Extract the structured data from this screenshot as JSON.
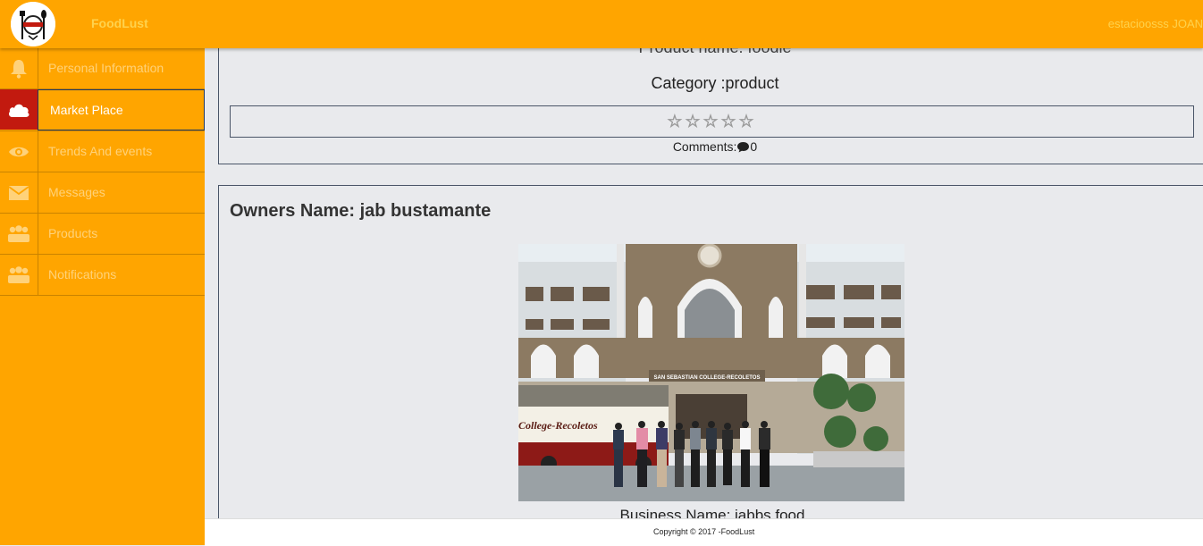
{
  "header": {
    "brand": "FoodLust",
    "user": "estacioosss JOAN",
    "colors": {
      "bar": "#ffa500",
      "brand_text": "#ffd24d"
    }
  },
  "sidebar": {
    "items": [
      {
        "label": "Personal Information",
        "icon": "bell-icon"
      },
      {
        "label": "Market Place",
        "icon": "cloud-icon",
        "active": true
      },
      {
        "label": "Trends And events",
        "icon": "eye-icon"
      },
      {
        "label": "Messages",
        "icon": "envelope-icon"
      },
      {
        "label": "Products",
        "icon": "users-icon"
      },
      {
        "label": "Notifications",
        "icon": "users-icon"
      }
    ],
    "colors": {
      "active_icon_bg": "#c21a0f",
      "active_border": "#233a5e"
    }
  },
  "product_card": {
    "product_name": "Product name: foodie",
    "category": "Category :product",
    "rating": {
      "value": 0,
      "max": 5
    },
    "comments_label": "Comments:",
    "comments_count": "0"
  },
  "owner_card": {
    "owner": "Owners Name: jab bustamante",
    "business": "Business Name: jabbs food",
    "photo_sign": "SAN SEBASTIAN COLLEGE-RECOLETOS",
    "bus_text": "College-Recoletos"
  },
  "footer": {
    "copyright": "Copyright © 2017 -FoodLust"
  }
}
